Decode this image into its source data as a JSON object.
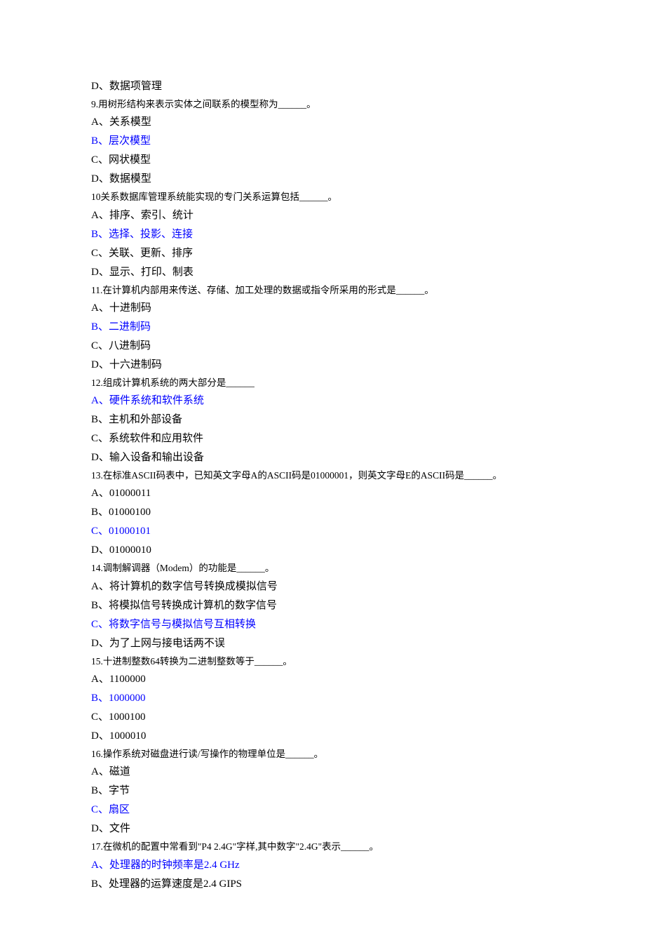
{
  "lines": [
    {
      "text": "D、数据项管理",
      "cls": "option-large"
    },
    {
      "text": "9.用树形结构来表示实体之间联系的模型称为______。",
      "cls": "question"
    },
    {
      "text": "A、关系模型",
      "cls": "option-large"
    },
    {
      "text": "B、层次模型",
      "cls": "option-large answer"
    },
    {
      "text": "C、网状模型",
      "cls": "option-large"
    },
    {
      "text": "D、数据模型",
      "cls": "option-large"
    },
    {
      "text": "10关系数据库管理系统能实现的专门关系运算包括______。",
      "cls": "question"
    },
    {
      "text": "A、排序、索引、统计",
      "cls": "option-large"
    },
    {
      "text": "B、选择、投影、连接",
      "cls": "option-large answer"
    },
    {
      "text": "C、关联、更新、排序",
      "cls": "option-large"
    },
    {
      "text": "D、显示、打印、制表",
      "cls": "option-large"
    },
    {
      "text": "11.在计算机内部用来传送、存储、加工处理的数据或指令所采用的形式是______。",
      "cls": "question"
    },
    {
      "text": "A、十进制码",
      "cls": "option-large"
    },
    {
      "text": "B、二进制码",
      "cls": "option-large answer"
    },
    {
      "text": "C、八进制码",
      "cls": "option-large"
    },
    {
      "text": "D、十六进制码",
      "cls": "option-large"
    },
    {
      "text": "12.组成计算机系统的两大部分是______",
      "cls": "question"
    },
    {
      "text": "A、硬件系统和软件系统",
      "cls": "option-large answer"
    },
    {
      "text": "B、主机和外部设备",
      "cls": "option-large"
    },
    {
      "text": "C、系统软件和应用软件",
      "cls": "option-large"
    },
    {
      "text": "D、输入设备和输出设备",
      "cls": "option-large"
    },
    {
      "text": "13.在标准ASCII码表中，已知英文字母A的ASCII码是01000001，则英文字母E的ASCII码是______。",
      "cls": "question"
    },
    {
      "text": "A、01000011",
      "cls": "option-large"
    },
    {
      "text": "B、01000100",
      "cls": "option-large"
    },
    {
      "text": "C、01000101",
      "cls": "option-large answer"
    },
    {
      "text": "D、01000010",
      "cls": "option-large"
    },
    {
      "text": "14.调制解调器（Modem）的功能是______。",
      "cls": "question"
    },
    {
      "text": "A、将计算机的数字信号转换成模拟信号",
      "cls": "option-large"
    },
    {
      "text": "B、将模拟信号转换成计算机的数字信号",
      "cls": "option-large"
    },
    {
      "text": "C、将数字信号与模拟信号互相转换",
      "cls": "option-large answer"
    },
    {
      "text": "D、为了上网与接电话两不误",
      "cls": "option-large"
    },
    {
      "text": "15.十进制整数64转换为二进制整数等于______。",
      "cls": "question"
    },
    {
      "text": "A、1100000",
      "cls": "option-large"
    },
    {
      "text": "B、1000000",
      "cls": "option-large answer"
    },
    {
      "text": "C、1000100",
      "cls": "option-large"
    },
    {
      "text": "D、1000010",
      "cls": "option-large"
    },
    {
      "text": "16.操作系统对磁盘进行读/写操作的物理单位是______。",
      "cls": "question"
    },
    {
      "text": "A、磁道",
      "cls": "option-large"
    },
    {
      "text": "B、字节",
      "cls": "option-large"
    },
    {
      "text": "C、扇区",
      "cls": "option-large answer"
    },
    {
      "text": "D、文件",
      "cls": "option-large"
    },
    {
      "text": "17.在微机的配置中常看到\"P4 2.4G\"字样,其中数字\"2.4G\"表示______。",
      "cls": "question"
    },
    {
      "text": "A、处理器的时钟频率是2.4 GHz",
      "cls": "option-large answer"
    },
    {
      "text": "B、处理器的运算速度是2.4 GIPS",
      "cls": "option-large"
    }
  ]
}
